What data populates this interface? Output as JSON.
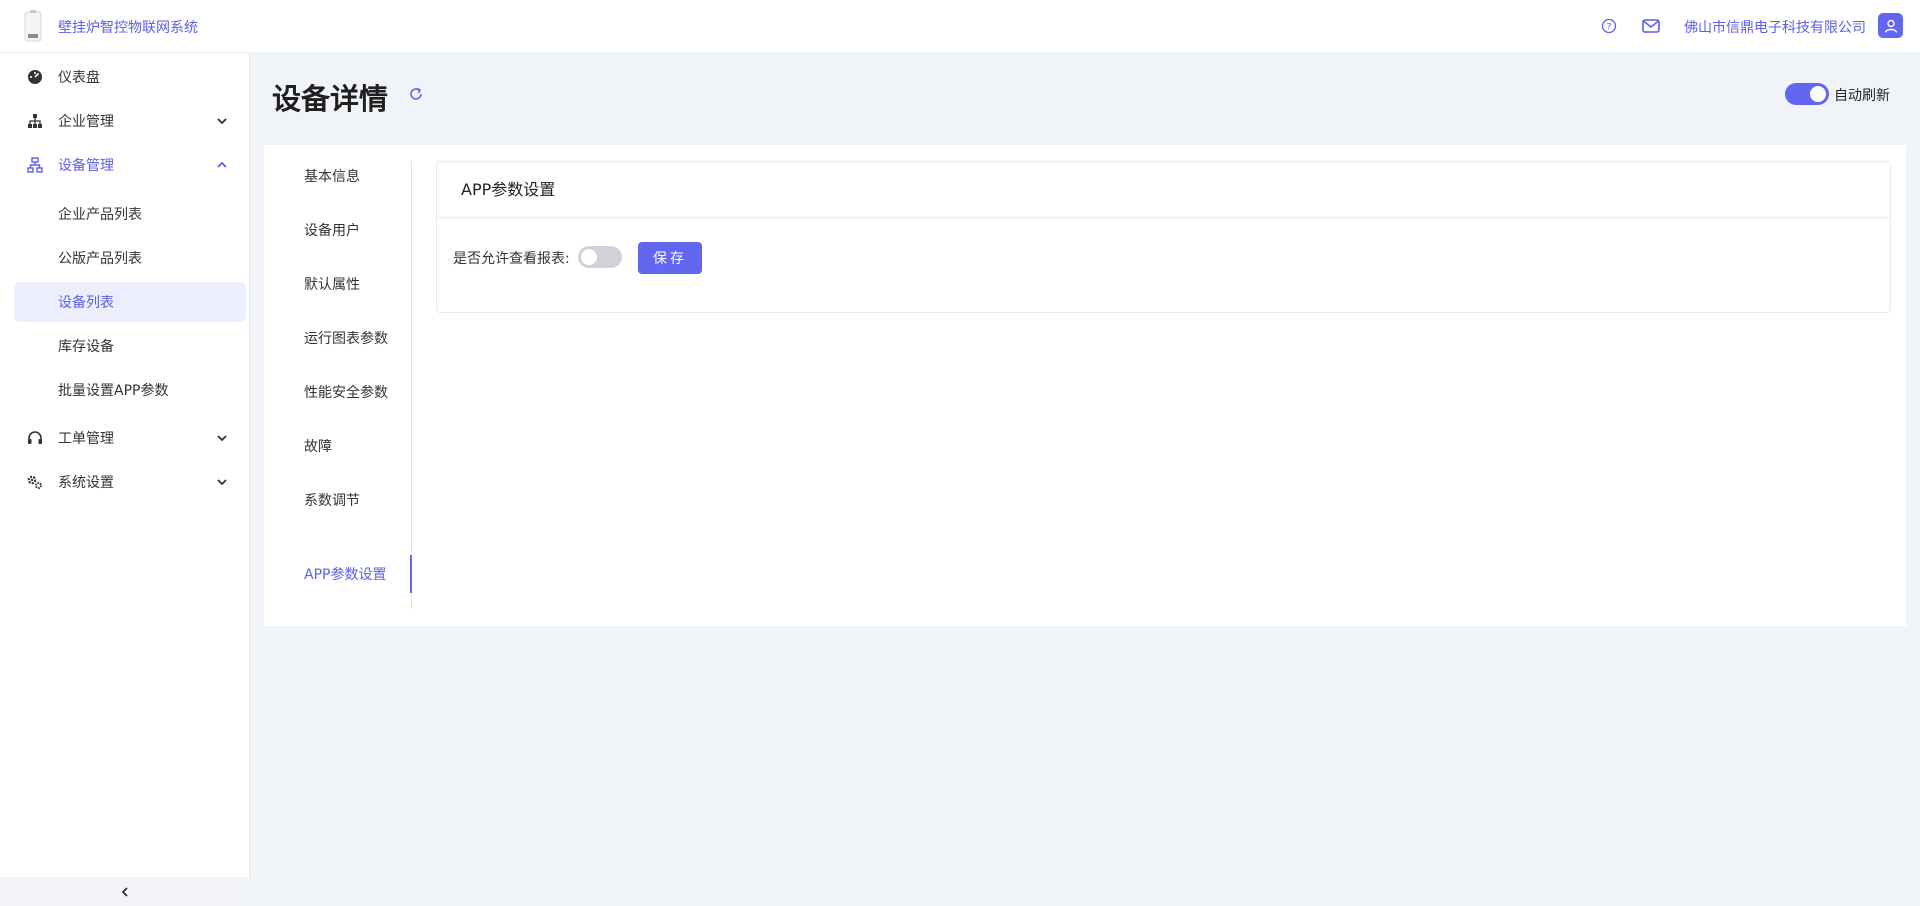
{
  "header": {
    "app_title": "壁挂炉智控物联网系统",
    "company": "佛山市信鼎电子科技有限公司",
    "icons": [
      "help-icon",
      "mail-icon",
      "user-icon"
    ]
  },
  "sidebar": {
    "items": [
      {
        "label": "仪表盘",
        "icon": "dashboard-icon"
      },
      {
        "label": "企业管理",
        "icon": "org-icon",
        "expanded": false
      },
      {
        "label": "设备管理",
        "icon": "network-icon",
        "expanded": true
      },
      {
        "label": "工单管理",
        "icon": "headset-icon",
        "expanded": false
      },
      {
        "label": "系统设置",
        "icon": "gears-icon",
        "expanded": false
      }
    ],
    "sub_items": [
      {
        "label": "企业产品列表"
      },
      {
        "label": "公版产品列表"
      },
      {
        "label": "设备列表",
        "active": true
      },
      {
        "label": "库存设备"
      },
      {
        "label": "批量设置APP参数"
      }
    ]
  },
  "main": {
    "title": "设备详情",
    "auto_refresh_label": "自动刷新",
    "auto_refresh_on": true,
    "tabs": [
      {
        "label": "基本信息"
      },
      {
        "label": "设备用户"
      },
      {
        "label": "默认属性"
      },
      {
        "label": "运行图表参数"
      },
      {
        "label": "性能安全参数"
      },
      {
        "label": "故障"
      },
      {
        "label": "系数调节"
      },
      {
        "label": "APP参数设置",
        "active": true
      }
    ],
    "panel": {
      "title": "APP参数设置",
      "field_label": "是否允许查看报表:",
      "field_on": false,
      "save_label": "保存"
    }
  },
  "colors": {
    "accent": "#6366f1",
    "background": "#f0f3f8"
  }
}
